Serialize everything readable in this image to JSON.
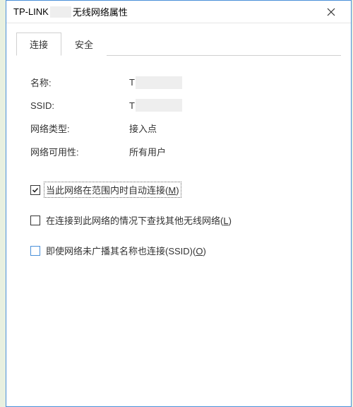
{
  "titlebar": {
    "prefix": "TP-LINK",
    "suffix": "无线网络属性"
  },
  "tabs": {
    "connection": "连接",
    "security": "安全"
  },
  "props": {
    "name_label": "名称:",
    "name_value": "T",
    "ssid_label": "SSID:",
    "ssid_value": "T",
    "type_label": "网络类型:",
    "type_value": "接入点",
    "avail_label": "网络可用性:",
    "avail_value": "所有用户"
  },
  "checkboxes": {
    "auto_connect": {
      "text": "当此网络在范围内时自动连接(",
      "accel": "M",
      "suffix": ")",
      "checked": true
    },
    "look_other": {
      "text": "在连接到此网络的情况下查找其他无线网络(",
      "accel": "L",
      "suffix": ")",
      "checked": false
    },
    "connect_hidden": {
      "text": "即使网络未广播其名称也连接(SSID)(",
      "accel": "O",
      "suffix": ")",
      "checked": false
    }
  }
}
